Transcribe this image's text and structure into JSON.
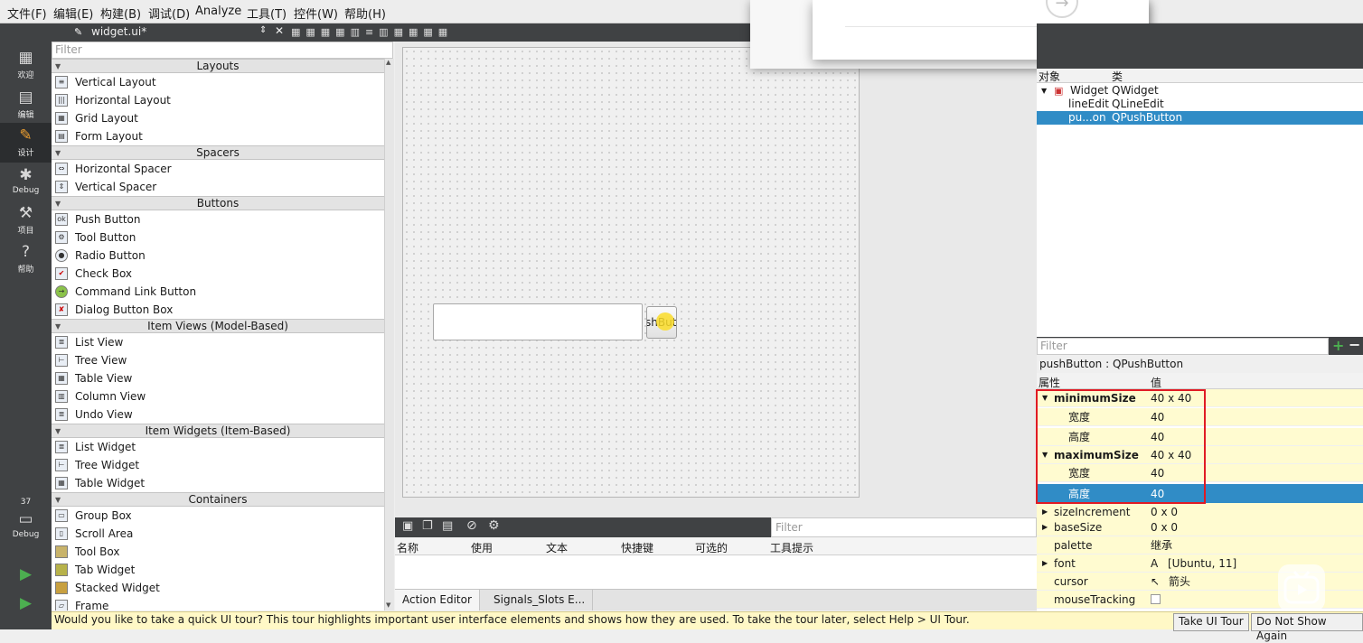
{
  "menu": [
    "文件(F)",
    "编辑(E)",
    "构建(B)",
    "调试(D)",
    "Analyze",
    "工具(T)",
    "控件(W)",
    "帮助(H)"
  ],
  "modes": [
    {
      "label": "欢迎",
      "icon": "grid-icon"
    },
    {
      "label": "编辑",
      "icon": "edit-document-icon"
    },
    {
      "label": "设计",
      "icon": "pencil-icon"
    },
    {
      "label": "Debug",
      "icon": "bug-icon"
    },
    {
      "label": "项目",
      "icon": "wrench-icon"
    },
    {
      "label": "帮助",
      "icon": "help-icon"
    }
  ],
  "kit": {
    "number": "37",
    "label": "Debug"
  },
  "editor": {
    "filename": "widget.ui*"
  },
  "widgetbox": {
    "filter_placeholder": "Filter",
    "categories": {
      "layouts": "Layouts",
      "spacers": "Spacers",
      "buttons": "Buttons",
      "item_views": "Item Views (Model-Based)",
      "item_widgets": "Item Widgets (Item-Based)",
      "containers": "Containers"
    },
    "items": {
      "vertical_layout": "Vertical Layout",
      "horizontal_layout": "Horizontal Layout",
      "grid_layout": "Grid Layout",
      "form_layout": "Form Layout",
      "horizontal_spacer": "Horizontal Spacer",
      "vertical_spacer": "Vertical Spacer",
      "push_button": "Push Button",
      "tool_button": "Tool Button",
      "radio_button": "Radio Button",
      "check_box": "Check Box",
      "command_link_button": "Command Link Button",
      "dialog_button_box": "Dialog Button Box",
      "list_view": "List View",
      "tree_view": "Tree View",
      "table_view": "Table View",
      "column_view": "Column View",
      "undo_view": "Undo View",
      "list_widget": "List Widget",
      "tree_widget": "Tree Widget",
      "table_widget": "Table Widget",
      "group_box": "Group Box",
      "scroll_area": "Scroll Area",
      "tool_box": "Tool Box",
      "tab_widget": "Tab Widget",
      "stacked_widget": "Stacked Widget",
      "frame": "Frame"
    }
  },
  "form": {
    "push_button_text": "shBut"
  },
  "action_editor": {
    "filter_placeholder": "Filter",
    "columns": [
      "名称",
      "使用",
      "文本",
      "快捷键",
      "可选的",
      "工具提示"
    ],
    "tabs": [
      "Action Editor",
      "Signals_Slots E..."
    ]
  },
  "object_inspector": {
    "columns": [
      "对象",
      "类"
    ],
    "rows": [
      {
        "name": "Widget",
        "class": "QWidget"
      },
      {
        "name": "lineEdit",
        "class": "QLineEdit"
      },
      {
        "name": "pu...on",
        "class": "QPushButton"
      }
    ]
  },
  "property_editor": {
    "filter_placeholder": "Filter",
    "title": "pushButton : QPushButton",
    "columns": [
      "属性",
      "值"
    ],
    "rows": {
      "minimumSize": {
        "name": "minimumSize",
        "value": "40 x 40"
      },
      "min_width": {
        "name": "宽度",
        "value": "40"
      },
      "min_height": {
        "name": "高度",
        "value": "40"
      },
      "maximumSize": {
        "name": "maximumSize",
        "value": "40 x 40"
      },
      "max_width": {
        "name": "宽度",
        "value": "40"
      },
      "max_height": {
        "name": "高度",
        "value": "40"
      },
      "sizeIncrement": {
        "name": "sizeIncrement",
        "value": "0 x 0"
      },
      "baseSize": {
        "name": "baseSize",
        "value": "0 x 0"
      },
      "palette": {
        "name": "palette",
        "value": "继承"
      },
      "font": {
        "name": "font",
        "value": "[Ubuntu, 11]"
      },
      "cursor": {
        "name": "cursor",
        "value": "箭头"
      },
      "mouseTracking": {
        "name": "mouseTracking",
        "value": ""
      }
    }
  },
  "tour": {
    "message": "Would you like to take a quick UI tour? This tour highlights important user interface elements and shows how they are used. To take the tour later, select Help > UI Tour.",
    "take_label": "Take UI Tour",
    "dismiss_label": "Do Not Show Again"
  },
  "colors": {
    "selection": "#308cc6",
    "highlight_box": "#e01b24",
    "changed_property": "#fffbd0"
  }
}
